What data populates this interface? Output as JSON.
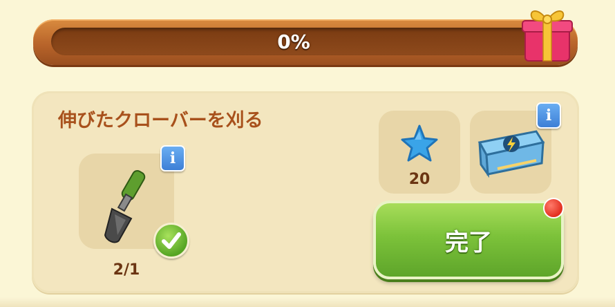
{
  "progress_bar": {
    "percent_label": "0%",
    "value": 0,
    "reward_icon": "gift-box-icon"
  },
  "quest": {
    "title": "伸びたクローバーを刈る",
    "tool": {
      "icon": "shovel-icon",
      "progress": "2/1",
      "info_label": "i",
      "completed_icon": "checkmark-icon"
    },
    "rewards": [
      {
        "icon": "blue-star-icon",
        "amount": "20"
      },
      {
        "icon": "energy-chest-icon",
        "info_label": "i"
      }
    ],
    "complete_button": {
      "label": "完了",
      "notification": true
    }
  },
  "colors": {
    "background": "#fbf6d6",
    "panel": "#f3e6bf",
    "title_text": "#a8511c",
    "button_green": "#7cc23a",
    "progress_frame": "#b8642a"
  }
}
